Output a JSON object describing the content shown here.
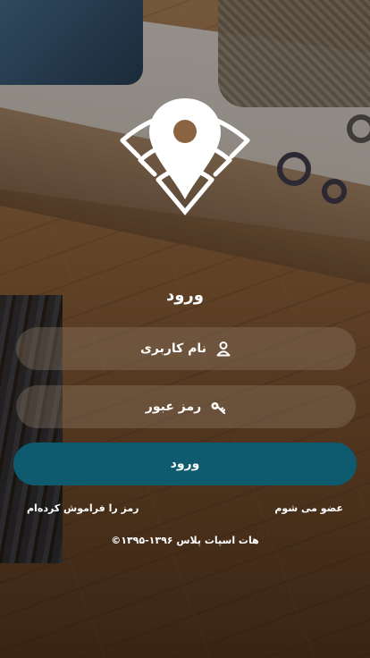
{
  "screen": {
    "title": "ورود"
  },
  "form": {
    "username_placeholder": "نام کاربری",
    "password_placeholder": "رمز عبور",
    "login_label": "ورود"
  },
  "links": {
    "forgot_password": "رمز را فراموش کرده‌ام",
    "signup": "عضو می شوم"
  },
  "footer": {
    "copyright": "©۱۳۹۵-۱۳۹۶ هات اسپات پلاس"
  },
  "colors": {
    "accent": "#0e5a6f",
    "text": "#ffffff"
  },
  "icons": {
    "logo": "location-pin-wifi-icon",
    "username": "user-icon",
    "password": "key-icon"
  }
}
